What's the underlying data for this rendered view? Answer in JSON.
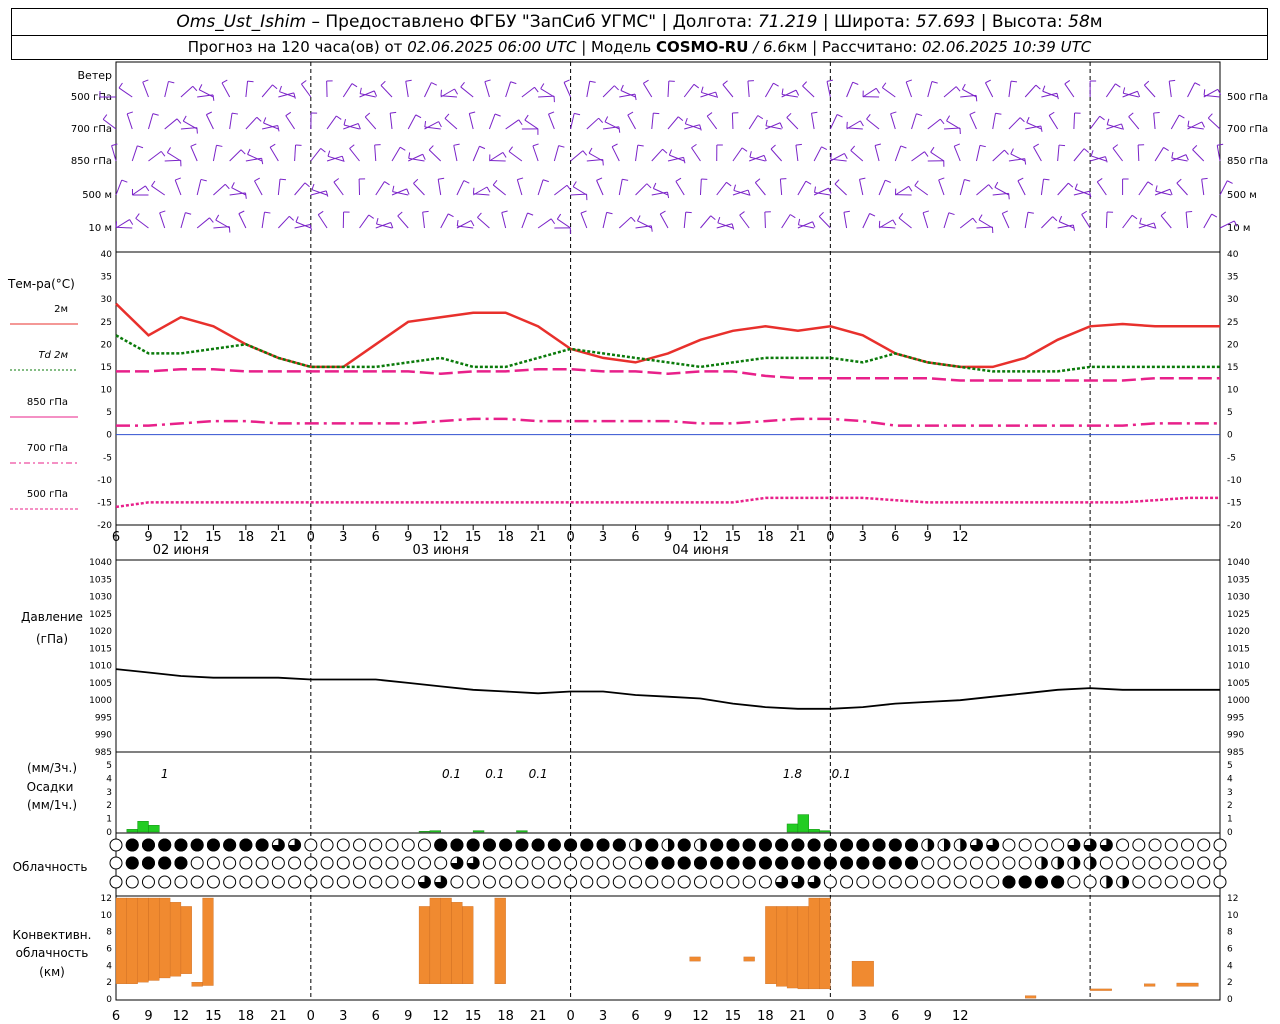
{
  "header": {
    "station": "Oms_Ust_Ishim",
    "provider": " – Предоставлено ФГБУ \"ЗапСиб УГМС\" | Долгота: ",
    "lon": "71.219",
    "lat_label": " | Широта: ",
    "lat": "57.693",
    "alt_label": " | Высота: ",
    "alt": "58",
    "alt_unit": "м",
    "forecast_pre": "Прогноз на 120 часа(ов) от ",
    "forecast_time": "02.06.2025 06:00 UTC",
    "model_label": "  | Модель ",
    "model": "COSMO-RU",
    "model_res": " / 6.6",
    "model_res_unit": "км",
    "calc_label": " | Рассчитано: ",
    "calc_time": "02.06.2025 10:39 UTC"
  },
  "colors": {
    "wind": "#7a22c8",
    "t2m": "#e8302c",
    "td2m": "#0a7a0a",
    "t850": "#e8208a",
    "precip": "#22cc22",
    "conv_cloud": "#f08a30",
    "grid": "#000000"
  },
  "x_axis": {
    "hour_labels": [
      "6",
      "9",
      "12",
      "15",
      "18",
      "21",
      "0",
      "3",
      "6",
      "9",
      "12",
      "15",
      "18",
      "21",
      "0",
      "3",
      "6",
      "9",
      "12",
      "15",
      "18",
      "21",
      "0",
      "3",
      "6",
      "9",
      "12"
    ],
    "day_labels": [
      "02 июня",
      "03 июня",
      "04 июня"
    ]
  },
  "wind": {
    "title": "Ветер",
    "levels": [
      "500 гПа",
      "700 гПа",
      "850 гПа",
      "500 м",
      "10 м"
    ]
  },
  "temp_panel": {
    "title": "Тем-ра(°С)",
    "legend": [
      "2м",
      "Td 2м",
      "850 гПа",
      "700 гПа",
      "500 гПа"
    ]
  },
  "pressure_panel": {
    "title": "Давление",
    "unit": "(гПа)"
  },
  "precip_panel": {
    "unit_3h": "(мм/3ч.)",
    "title": "Осадки",
    "unit_1h": "(мм/1ч.)",
    "amounts": [
      "1",
      "0.1",
      "0.1",
      "0.1",
      "1.8",
      "0.1"
    ]
  },
  "cloud_panel": {
    "title": "Облачность"
  },
  "conv_panel": {
    "title1": "Конвективн.",
    "title2": "облачность",
    "title3": "(км)"
  },
  "chart_data": [
    {
      "type": "line",
      "title": "Тем-ра(°С)",
      "x_hours_from_start": [
        0,
        3,
        6,
        9,
        12,
        15,
        18,
        21,
        24,
        27,
        30,
        33,
        36,
        39,
        42,
        45,
        48,
        51,
        54,
        57,
        60,
        63,
        66,
        69,
        72,
        75,
        78,
        81,
        84,
        87,
        90,
        93,
        96,
        99,
        102
      ],
      "ylim": [
        -20,
        40
      ],
      "series": [
        {
          "name": "2м",
          "values": [
            29,
            22,
            26,
            24,
            20,
            17,
            15,
            15,
            20,
            25,
            26,
            27,
            27,
            24,
            19,
            17,
            16,
            18,
            21,
            23,
            24,
            23,
            24,
            22,
            18,
            16,
            15,
            15,
            17,
            21,
            24,
            24.5,
            24,
            24,
            24
          ]
        },
        {
          "name": "Td 2м",
          "values": [
            22,
            18,
            18,
            19,
            20,
            17,
            15,
            15,
            15,
            16,
            17,
            15,
            15,
            17,
            19,
            18,
            17,
            16,
            15,
            16,
            17,
            17,
            17,
            16,
            18,
            16,
            15,
            14,
            14,
            14,
            15,
            15,
            15,
            15,
            15
          ]
        },
        {
          "name": "850 гПа",
          "values": [
            14,
            14,
            14.5,
            14.5,
            14,
            14,
            14,
            14,
            14,
            14,
            13.5,
            14,
            14,
            14.5,
            14.5,
            14,
            14,
            13.5,
            14,
            14,
            13,
            12.5,
            12.5,
            12.5,
            12.5,
            12.5,
            12,
            12,
            12,
            12,
            12,
            12,
            12.5,
            12.5,
            12.5
          ]
        },
        {
          "name": "700 гПа",
          "values": [
            2,
            2,
            2.5,
            3,
            3,
            2.5,
            2.5,
            2.5,
            2.5,
            2.5,
            3,
            3.5,
            3.5,
            3,
            3,
            3,
            3,
            3,
            2.5,
            2.5,
            3,
            3.5,
            3.5,
            3,
            2,
            2,
            2,
            2,
            2,
            2,
            2,
            2,
            2.5,
            2.5,
            2.5
          ]
        },
        {
          "name": "500 гПа",
          "values": [
            -16,
            -15,
            -15,
            -15,
            -15,
            -15,
            -15,
            -15,
            -15,
            -15,
            -15,
            -15,
            -15,
            -15,
            -15,
            -15,
            -15,
            -15,
            -15,
            -15,
            -14,
            -14,
            -14,
            -14,
            -14.5,
            -15,
            -15,
            -15,
            -15,
            -15,
            -15,
            -15,
            -14.5,
            -14,
            -14
          ]
        }
      ]
    },
    {
      "type": "line",
      "title": "Давление",
      "x_hours_from_start": [
        0,
        3,
        6,
        9,
        12,
        15,
        18,
        21,
        24,
        27,
        30,
        33,
        36,
        39,
        42,
        45,
        48,
        51,
        54,
        57,
        60,
        63,
        66,
        69,
        72,
        75,
        78,
        81,
        84,
        87,
        90,
        93,
        96,
        99,
        102
      ],
      "ylim": [
        985,
        1040
      ],
      "series": [
        {
          "name": "",
          "values": [
            1009,
            1008,
            1007,
            1006.5,
            1006.5,
            1006.5,
            1006,
            1006,
            1006,
            1005,
            1004,
            1003,
            1002.5,
            1002,
            1002.5,
            1002.5,
            1001.5,
            1001,
            1000.5,
            999,
            998,
            997.5,
            997.5,
            998,
            999,
            999.5,
            1000,
            1001,
            1002,
            1003,
            1003.5,
            1003,
            1003,
            1003,
            1003
          ]
        }
      ]
    },
    {
      "type": "bar",
      "title": "Осадки",
      "ylim": [
        0,
        5
      ],
      "bars": [
        {
          "x": 1,
          "value": 0.2
        },
        {
          "x": 2,
          "value": 0.8
        },
        {
          "x": 3,
          "value": 0.5
        },
        {
          "x": 28,
          "value": 0.05
        },
        {
          "x": 29,
          "value": 0.1
        },
        {
          "x": 33,
          "value": 0.1
        },
        {
          "x": 37,
          "value": 0.1
        },
        {
          "x": 62,
          "value": 0.6
        },
        {
          "x": 63,
          "value": 1.3
        },
        {
          "x": 64,
          "value": 0.2
        },
        {
          "x": 65,
          "value": 0.1
        }
      ]
    },
    {
      "type": "bar",
      "title": "Конвективн. облачность (км)",
      "ylim": [
        0,
        13
      ],
      "bars": [
        {
          "x0": 0,
          "x1": 1,
          "low": 1.8,
          "high": 12
        },
        {
          "x0": 1,
          "x1": 2,
          "low": 1.8,
          "high": 12
        },
        {
          "x0": 2,
          "x1": 3,
          "low": 2,
          "high": 12
        },
        {
          "x0": 3,
          "x1": 4,
          "low": 2.2,
          "high": 12
        },
        {
          "x0": 4,
          "x1": 5,
          "low": 2.5,
          "high": 12
        },
        {
          "x0": 5,
          "x1": 6,
          "low": 2.7,
          "high": 11.5
        },
        {
          "x0": 6,
          "x1": 7,
          "low": 3,
          "high": 11
        },
        {
          "x0": 7,
          "x1": 8,
          "low": 1.5,
          "high": 2
        },
        {
          "x0": 8,
          "x1": 9,
          "low": 1.6,
          "high": 12
        },
        {
          "x0": 28,
          "x1": 29,
          "low": 1.8,
          "high": 11
        },
        {
          "x0": 29,
          "x1": 30,
          "low": 1.8,
          "high": 12
        },
        {
          "x0": 30,
          "x1": 31,
          "low": 1.8,
          "high": 12
        },
        {
          "x0": 31,
          "x1": 32,
          "low": 1.8,
          "high": 11.5
        },
        {
          "x0": 32,
          "x1": 33,
          "low": 1.8,
          "high": 11
        },
        {
          "x0": 35,
          "x1": 36,
          "low": 1.8,
          "high": 12
        },
        {
          "x0": 53,
          "x1": 54,
          "low": 4.5,
          "high": 5
        },
        {
          "x0": 58,
          "x1": 59,
          "low": 4.5,
          "high": 5
        },
        {
          "x0": 60,
          "x1": 61,
          "low": 1.8,
          "high": 11
        },
        {
          "x0": 61,
          "x1": 62,
          "low": 1.5,
          "high": 11
        },
        {
          "x0": 62,
          "x1": 63,
          "low": 1.3,
          "high": 11
        },
        {
          "x0": 63,
          "x1": 64,
          "low": 1.2,
          "high": 11
        },
        {
          "x0": 64,
          "x1": 65,
          "low": 1.2,
          "high": 12
        },
        {
          "x0": 65,
          "x1": 66,
          "low": 1.2,
          "high": 12
        },
        {
          "x0": 68,
          "x1": 70,
          "low": 1.5,
          "high": 4.5
        },
        {
          "x0": 84,
          "x1": 85,
          "low": 0.1,
          "high": 0.4
        },
        {
          "x0": 90,
          "x1": 92,
          "low": 1,
          "high": 1.2
        },
        {
          "x0": 95,
          "x1": 96,
          "low": 1.5,
          "high": 1.8
        },
        {
          "x0": 98,
          "x1": 100,
          "low": 1.5,
          "high": 1.9
        }
      ]
    }
  ]
}
